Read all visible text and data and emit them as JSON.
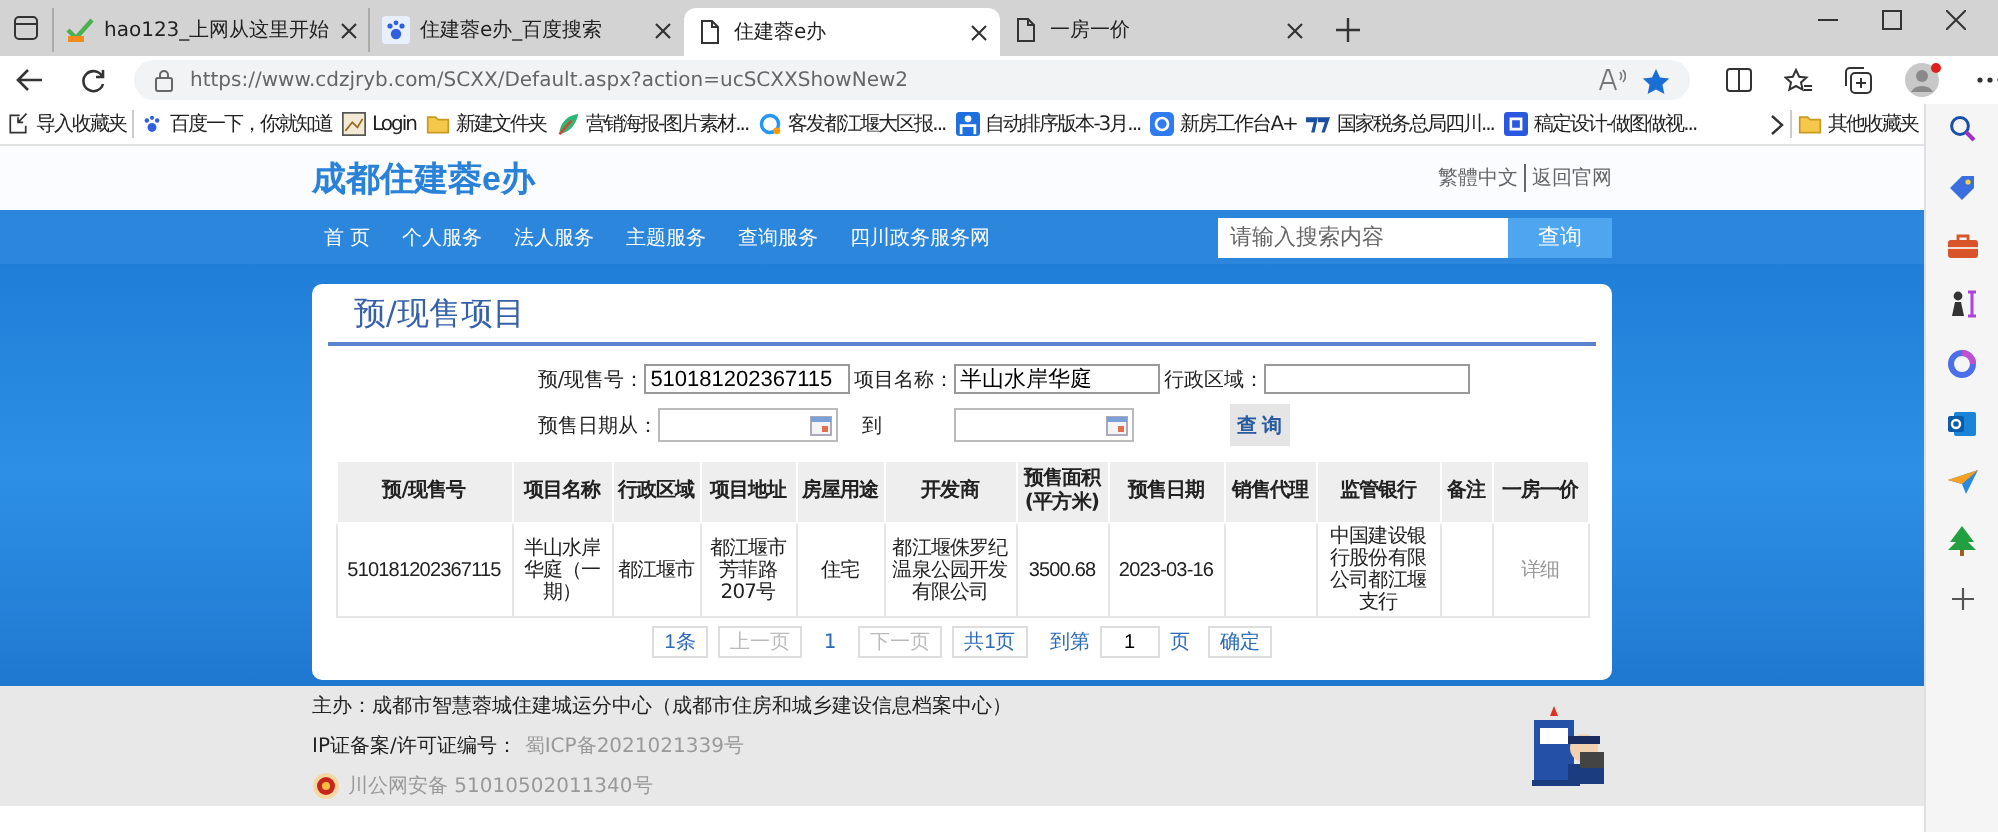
{
  "browser": {
    "tabs": [
      {
        "title": "hao123_上网从这里开始",
        "kind": "hao",
        "selected": false
      },
      {
        "title": "住建蓉e办_百度搜索",
        "kind": "paw",
        "selected": false
      },
      {
        "title": "住建蓉e办",
        "kind": "page",
        "selected": true
      },
      {
        "title": "一房一价",
        "kind": "page",
        "selected": false
      }
    ],
    "url": "https://www.cdzjryb.com/SCXX/Default.aspx?action=ucSCXXShowNew2",
    "bookmarks": [
      {
        "label": "导入收藏夹",
        "kind": "import"
      },
      {
        "label": "百度一下，你就知道",
        "kind": "paw"
      },
      {
        "label": "Login",
        "kind": "image"
      },
      {
        "label": "新建文件夹",
        "kind": "folder"
      },
      {
        "label": "营销海报-图片素材...",
        "kind": "leaf"
      },
      {
        "label": "客发都江堰大区报...",
        "kind": "ring"
      },
      {
        "label": "自动排序版本-3月...",
        "kind": "person"
      },
      {
        "label": "新房工作台A+",
        "kind": "circle"
      },
      {
        "label": "国家税务总局四川...",
        "kind": "tax"
      },
      {
        "label": "稿定设计-做图做视...",
        "kind": "square"
      }
    ],
    "other_bookmarks": "其他收藏夹"
  },
  "site": {
    "title": "成都住建蓉e办",
    "lang_links": [
      "繁體中文",
      "返回官网"
    ],
    "nav": [
      "首 页",
      "个人服务",
      "法人服务",
      "主题服务",
      "查询服务",
      "四川政务服务网"
    ],
    "search": {
      "placeholder": "请输入搜索内容",
      "button": "查询"
    }
  },
  "panel": {
    "title": "预/现售项目",
    "fields": [
      {
        "label": "预/现售号：",
        "value": "510181202367115",
        "kind": "text"
      },
      {
        "label": "项目名称：",
        "value": "半山水岸华庭",
        "kind": "text"
      },
      {
        "label": "行政区域：",
        "kind": "text"
      },
      {
        "label": "预售日期从：",
        "kind": "date"
      },
      {
        "label": "到",
        "kind": "date"
      }
    ],
    "search_button": "查 询",
    "table": {
      "columns": [
        "预/现售号",
        "项目名称",
        "行政区域",
        "项目地址",
        "房屋用途",
        "开发商",
        "预售面积(平方米)",
        "预售日期",
        "销售代理",
        "监管银行",
        "备注",
        "一房一价"
      ],
      "rows": [
        {
          "cells": [
            "510181202367115",
            "半山水岸华庭（一期）",
            "都江堰市",
            "都江堰市芳菲路207号",
            "住宅",
            "都江堰侏罗纪温泉公园开发有限公司",
            "3500.68",
            "2023-03-16",
            "",
            "中国建设银行股份有限公司都江堰支行",
            ""
          ],
          "link": "详细"
        }
      ]
    },
    "pager": {
      "items": [
        {
          "label": "1条",
          "kind": "button",
          "disabled": false
        },
        {
          "label": "上一页",
          "kind": "button",
          "disabled": true
        },
        {
          "label": "1",
          "kind": "current",
          "disabled": false
        },
        {
          "label": "下一页",
          "kind": "button",
          "disabled": true
        },
        {
          "label": "共1页",
          "kind": "button",
          "disabled": false
        }
      ],
      "jump_before": "到第",
      "jump_value": "1",
      "jump_after": "页",
      "jump_button": "确定"
    }
  },
  "footer": {
    "sponsor": "主办：成都市智慧蓉城住建城运分中心（成都市住房和城乡建设信息档案中心）",
    "icp_label": "IP证备案/许可证编号：",
    "icp": "蜀ICP备2021021339号",
    "police": "川公网安备  51010502011340号"
  }
}
